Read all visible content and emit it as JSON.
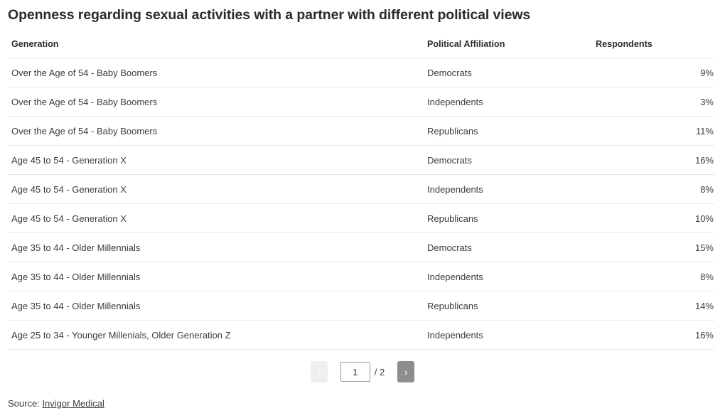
{
  "title": "Openness regarding sexual activities with a partner with different political views",
  "table": {
    "columns": [
      {
        "key": "generation",
        "label": "Generation",
        "align": "left"
      },
      {
        "key": "affiliation",
        "label": "Political Affiliation",
        "align": "left"
      },
      {
        "key": "respondents",
        "label": "Respondents",
        "align": "right"
      }
    ],
    "rows": [
      {
        "generation": "Over the Age of 54 - Baby Boomers",
        "affiliation": "Democrats",
        "respondents": "9%"
      },
      {
        "generation": "Over the Age of 54 - Baby Boomers",
        "affiliation": "Independents",
        "respondents": "3%"
      },
      {
        "generation": "Over the Age of 54 - Baby Boomers",
        "affiliation": "Republicans",
        "respondents": "11%"
      },
      {
        "generation": "Age 45 to 54 - Generation X",
        "affiliation": "Democrats",
        "respondents": "16%"
      },
      {
        "generation": "Age 45 to 54 - Generation X",
        "affiliation": "Independents",
        "respondents": "8%"
      },
      {
        "generation": "Age 45 to 54 - Generation X",
        "affiliation": "Republicans",
        "respondents": "10%"
      },
      {
        "generation": "Age 35 to 44 - Older Millennials",
        "affiliation": "Democrats",
        "respondents": "15%"
      },
      {
        "generation": "Age 35 to 44 - Older Millennials",
        "affiliation": "Independents",
        "respondents": "8%"
      },
      {
        "generation": "Age 35 to 44 - Older Millennials",
        "affiliation": "Republicans",
        "respondents": "14%"
      },
      {
        "generation": "Age 25 to 34 - Younger Millenials, Older Generation Z",
        "affiliation": "Independents",
        "respondents": "16%"
      }
    ]
  },
  "pagination": {
    "prev_label": "‹",
    "next_label": "›",
    "current_page": "1",
    "total_label": "/ 2",
    "total_pages": 2,
    "prev_enabled": false,
    "next_enabled": true
  },
  "footer": {
    "source_prefix": "Source:",
    "source_link_text": "Invigor Medical"
  },
  "chart_data": {
    "type": "table",
    "title": "Openness regarding sexual activities with a partner with different political views",
    "columns": [
      "Generation",
      "Political Affiliation",
      "Respondents"
    ],
    "rows": [
      [
        "Over the Age of 54 - Baby Boomers",
        "Democrats",
        "9%"
      ],
      [
        "Over the Age of 54 - Baby Boomers",
        "Independents",
        "3%"
      ],
      [
        "Over the Age of 54 - Baby Boomers",
        "Republicans",
        "11%"
      ],
      [
        "Age 45 to 54 - Generation X",
        "Democrats",
        "16%"
      ],
      [
        "Age 45 to 54 - Generation X",
        "Independents",
        "8%"
      ],
      [
        "Age 45 to 54 - Generation X",
        "Republicans",
        "10%"
      ],
      [
        "Age 35 to 44 - Older Millennials",
        "Democrats",
        "15%"
      ],
      [
        "Age 35 to 44 - Older Millennials",
        "Independents",
        "8%"
      ],
      [
        "Age 35 to 44 - Older Millennials",
        "Republicans",
        "14%"
      ],
      [
        "Age 25 to 34 - Younger Millenials, Older Generation Z",
        "Independents",
        "16%"
      ]
    ],
    "values": [
      9,
      3,
      11,
      16,
      8,
      10,
      15,
      8,
      14,
      16
    ],
    "unit": "percent",
    "page": 1,
    "total_pages": 2,
    "source": "Invigor Medical"
  }
}
